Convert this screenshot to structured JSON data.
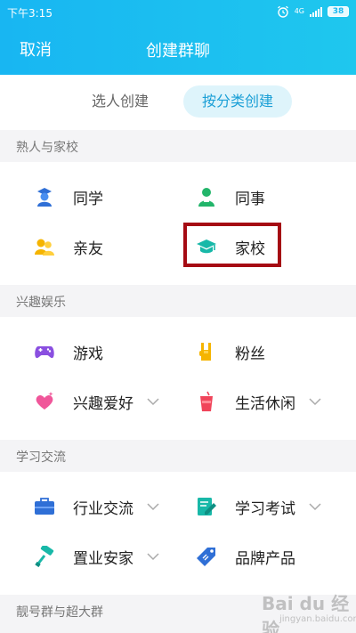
{
  "status": {
    "time": "下午3:15",
    "network": "4G",
    "battery": "38"
  },
  "header": {
    "cancel": "取消",
    "title": "创建群聊"
  },
  "tabs": [
    {
      "label": "选人创建",
      "active": false
    },
    {
      "label": "按分类创建",
      "active": true
    }
  ],
  "sections": [
    {
      "title": "熟人与家校",
      "items": [
        {
          "label": "同学",
          "icon": "graduate-student-icon"
        },
        {
          "label": "同事",
          "icon": "colleague-person-icon"
        },
        {
          "label": "亲友",
          "icon": "friends-people-icon"
        },
        {
          "label": "家校",
          "icon": "mortarboard-icon"
        }
      ]
    },
    {
      "title": "兴趣娱乐",
      "items": [
        {
          "label": "游戏",
          "icon": "gamepad-icon"
        },
        {
          "label": "粉丝",
          "icon": "rock-hand-icon"
        },
        {
          "label": "兴趣爱好",
          "icon": "heart-sparkle-icon",
          "expandable": true
        },
        {
          "label": "生活休闲",
          "icon": "drink-cup-icon",
          "expandable": true
        }
      ]
    },
    {
      "title": "学习交流",
      "items": [
        {
          "label": "行业交流",
          "icon": "briefcase-icon",
          "expandable": true
        },
        {
          "label": "学习考试",
          "icon": "exam-pencil-icon",
          "expandable": true
        },
        {
          "label": "置业安家",
          "icon": "paint-roller-icon",
          "expandable": true
        },
        {
          "label": "品牌产品",
          "icon": "price-tag-icon"
        }
      ]
    },
    {
      "title": "靓号群与超大群",
      "items": []
    }
  ],
  "watermark": {
    "text": "Bai du 经验",
    "sub": "jingyan.baidu.com"
  },
  "colors": {
    "header": "#18b6f2",
    "accent": "#1a9fd6",
    "highlight": "#a50b13"
  }
}
